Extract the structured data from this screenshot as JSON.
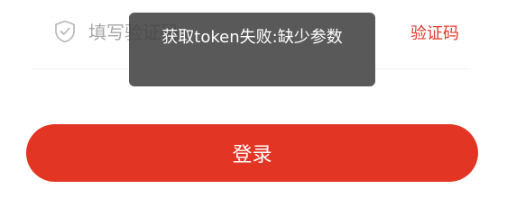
{
  "form": {
    "code_placeholder": "填写验证码",
    "code_value": "",
    "get_code_label": "验证码",
    "login_label": "登录"
  },
  "icons": {
    "code_field": "shield-check-icon"
  },
  "toast": {
    "message": "获取token失败:缺少参数"
  },
  "colors": {
    "accent": "#e33524",
    "link": "#e23a2c",
    "toast_bg": "#424242",
    "placeholder": "#a7a7a7"
  }
}
